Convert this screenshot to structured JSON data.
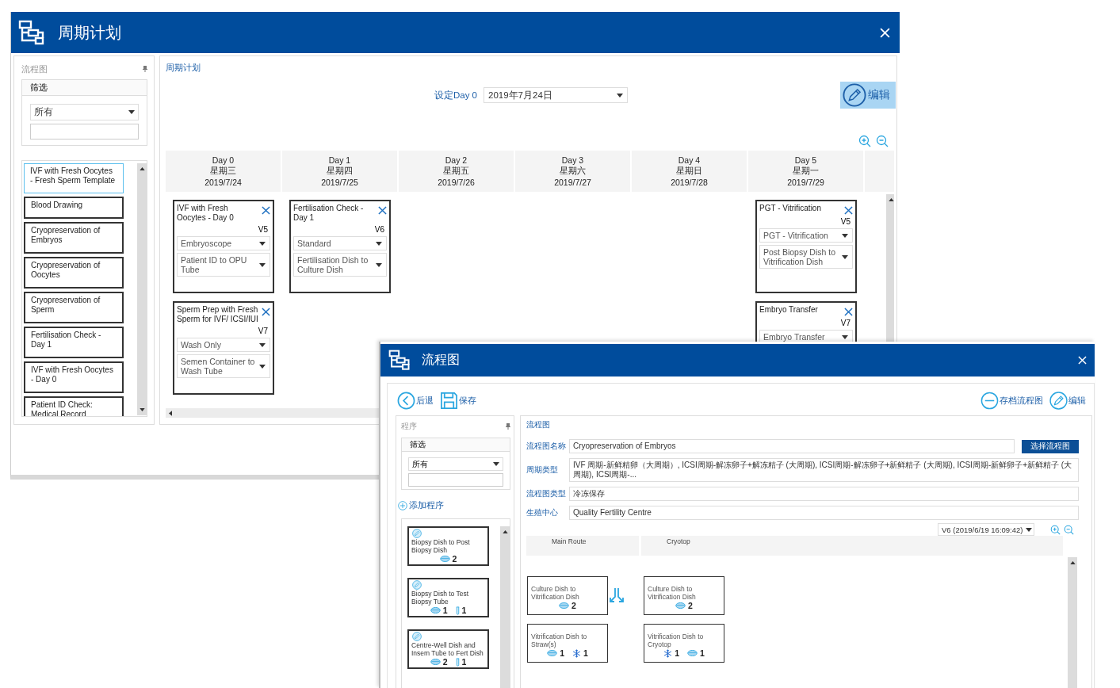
{
  "cycle_window": {
    "title": "周期计划",
    "sidebar": {
      "title": "流程图",
      "filter_title": "筛选",
      "filter_value": "所有",
      "items": [
        {
          "label": "IVF with Fresh Oocytes - Fresh Sperm Template",
          "selected": true
        },
        {
          "label": "Blood Drawing",
          "selected": false
        },
        {
          "label": "Cryopreservation of Embryos",
          "selected": false
        },
        {
          "label": "Cryopreservation of Oocytes",
          "selected": false
        },
        {
          "label": "Cryopreservation of Sperm",
          "selected": false
        },
        {
          "label": "Fertilisation Check - Day 1",
          "selected": false
        },
        {
          "label": "IVF with Fresh Oocytes - Day 0",
          "selected": false
        },
        {
          "label": "Patient ID Check: Medical Record",
          "selected": false
        }
      ]
    },
    "plan": {
      "title": "周期计划",
      "day0_label": "设定Day 0",
      "day0_value": "2019年7月24日",
      "edit": "编辑",
      "days": [
        {
          "day": "Day 0",
          "weekday": "星期三",
          "date": "2019/7/24",
          "cards": [
            {
              "title": "IVF with Fresh Oocytes - Day 0",
              "version": "V5",
              "selects": [
                "Embryoscope",
                "Patient ID to OPU Tube"
              ]
            },
            {
              "title": "Sperm Prep with Fresh Sperm for IVF/ ICSI/IUI",
              "version": "V7",
              "selects": [
                "Wash Only",
                "Semen Container to Wash Tube"
              ]
            }
          ]
        },
        {
          "day": "Day 1",
          "weekday": "星期四",
          "date": "2019/7/25",
          "cards": [
            {
              "title": "Fertilisation Check - Day 1",
              "version": "V6",
              "selects": [
                "Standard",
                "Fertilisation Dish to Culture Dish"
              ]
            }
          ]
        },
        {
          "day": "Day 2",
          "weekday": "星期五",
          "date": "2019/7/26"
        },
        {
          "day": "Day 3",
          "weekday": "星期六",
          "date": "2019/7/27"
        },
        {
          "day": "Day 4",
          "weekday": "星期日",
          "date": "2019/7/28"
        },
        {
          "day": "Day 5",
          "weekday": "星期一",
          "date": "2019/7/29",
          "cards": [
            {
              "title": "PGT - Vitrification",
              "version": "V5",
              "selects": [
                "PGT - Vitrification",
                "Post Biopsy Dish to Vitrification Dish"
              ]
            },
            {
              "title": "Embryo Transfer",
              "version": "V7",
              "selects": [
                "Embryo Transfer"
              ]
            }
          ]
        }
      ]
    }
  },
  "flowchart_window": {
    "title": "流程图",
    "toolbar": {
      "back": "后退",
      "save": "保存",
      "archive": "存档流程图",
      "edit": "编辑"
    },
    "programs": {
      "title": "程序",
      "filter_title": "筛选",
      "filter_value": "所有",
      "add": "添加程序",
      "items": [
        {
          "label": "Biopsy Dish to Post Biopsy Dish",
          "counts": [
            {
              "kind": "dish",
              "count": "2"
            }
          ]
        },
        {
          "label": "Biopsy Dish to Test Biopsy Tube",
          "counts": [
            {
              "kind": "dish",
              "count": "1"
            },
            {
              "kind": "tube",
              "count": "1"
            }
          ]
        },
        {
          "label": "Centre-Well Dish and Insem Tube to Fert Dish",
          "counts": [
            {
              "kind": "dish",
              "count": "2"
            },
            {
              "kind": "tube",
              "count": "1"
            }
          ]
        }
      ]
    },
    "flowchart": {
      "title": "流程图",
      "fields": [
        {
          "label": "流程图名称",
          "value": "Cryopreservation of Embryos",
          "button": "选择流程图"
        },
        {
          "label": "周期类型",
          "value": "IVF 周期-新鲜精卵（大周期）, ICSI周期-解冻卵子+解冻精子 (大周期), ICSI周期-解冻卵子+新鲜精子 (大周期), ICSI周期-新鲜卵子+新鲜精子 (大周期), ICSI周期-..."
        },
        {
          "label": "流程图类型",
          "value": "冷冻保存"
        },
        {
          "label": "生殖中心",
          "value": "Quality Fertility Centre"
        }
      ],
      "version": "V6 (2019/6/19 16:09:42)",
      "lanes": [
        {
          "name": "Main Route",
          "steps": [
            {
              "label": "Culture Dish to Vitrification Dish",
              "counts": [
                {
                  "kind": "dish",
                  "count": "2"
                }
              ]
            },
            {
              "label": "Vitrification Dish to Straw(s)",
              "counts": [
                {
                  "kind": "dish",
                  "count": "1"
                },
                {
                  "kind": "snow",
                  "count": "1"
                }
              ]
            }
          ]
        },
        {
          "name": "Cryotop",
          "steps": [
            {
              "label": "Culture Dish to Vitrification Dish",
              "counts": [
                {
                  "kind": "dish",
                  "count": "2"
                }
              ]
            },
            {
              "label": "Vitrification Dish to Cryotop",
              "counts": [
                {
                  "kind": "snow",
                  "count": "1"
                },
                {
                  "kind": "dish",
                  "count": "1"
                }
              ]
            }
          ]
        }
      ]
    }
  }
}
